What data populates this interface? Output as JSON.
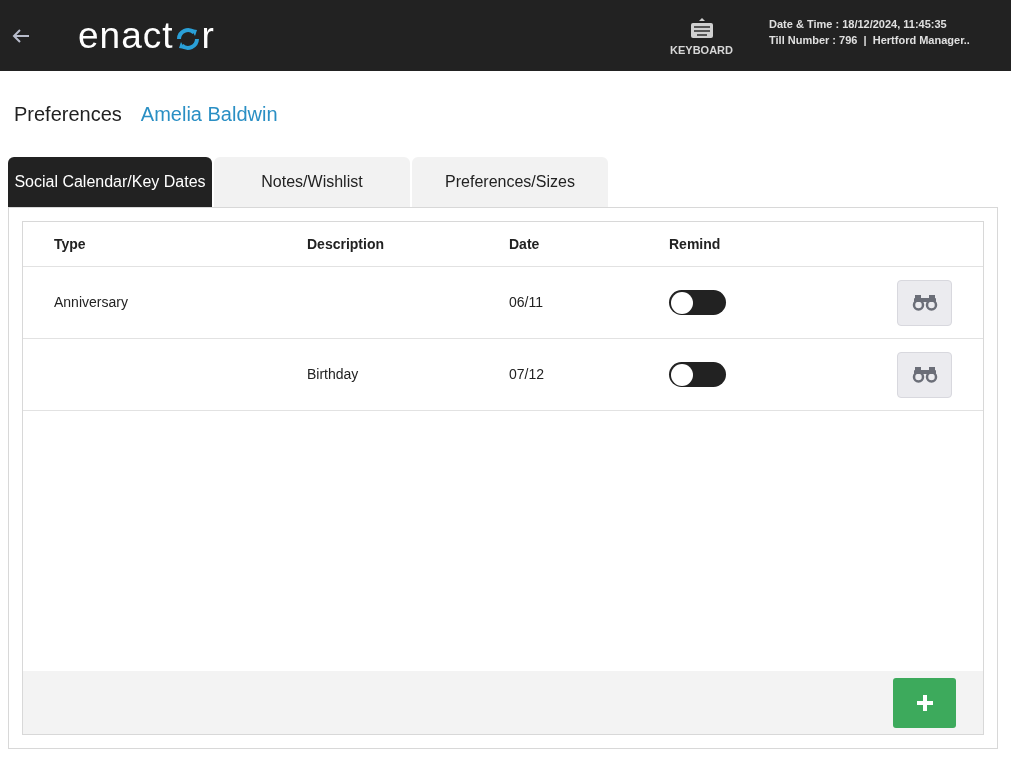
{
  "header": {
    "logo": {
      "before": "enact",
      "after": "r"
    },
    "keyboard_label": "KEYBOARD",
    "date_time": "Date & Time : 18/12/2024, 11:45:35",
    "till_info": "Till Number : 796  |  Hertford Manager.."
  },
  "page": {
    "title": "Preferences",
    "customer": "Amelia Baldwin"
  },
  "tabs": [
    {
      "label": "Social Calendar/Key Dates",
      "selected": true
    },
    {
      "label": "Notes/Wishlist",
      "selected": false
    },
    {
      "label": "Preferences/Sizes",
      "selected": false
    }
  ],
  "table": {
    "columns": [
      "Type",
      "Description",
      "Date",
      "Remind"
    ],
    "rows": [
      {
        "type": "Anniversary",
        "description": "",
        "date": "06/11",
        "remind": false
      },
      {
        "type": "",
        "description": "Birthday",
        "date": "07/12",
        "remind": false
      }
    ]
  }
}
